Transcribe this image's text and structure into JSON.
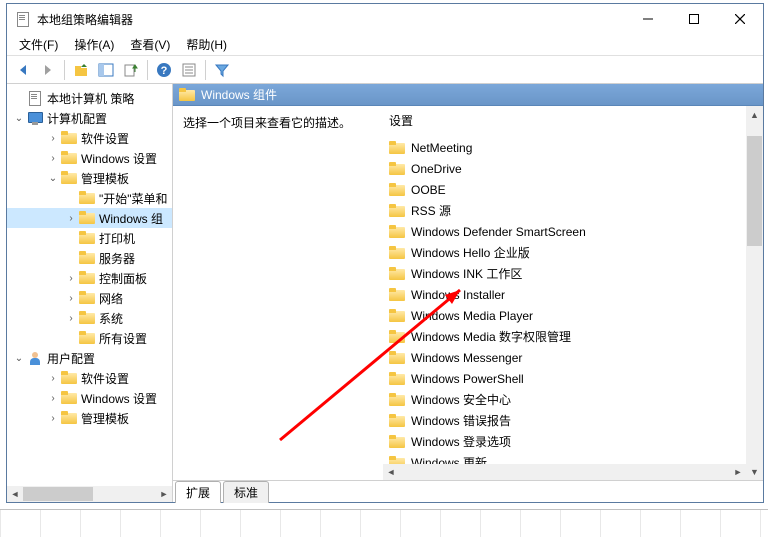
{
  "window": {
    "title": "本地组策略编辑器"
  },
  "menu": {
    "file": "文件(F)",
    "action": "操作(A)",
    "view": "查看(V)",
    "help": "帮助(H)"
  },
  "tree": {
    "root": "本地计算机 策略",
    "computer": "计算机配置",
    "software": "软件设置",
    "windows_settings": "Windows 设置",
    "admin_templates": "管理模板",
    "start_menu": "\"开始\"菜单和",
    "windows_components": "Windows 组",
    "printer": "打印机",
    "server": "服务器",
    "control_panel": "控制面板",
    "network": "网络",
    "system": "系统",
    "all_settings": "所有设置",
    "user": "用户配置",
    "user_software": "软件设置",
    "user_windows": "Windows 设置",
    "user_admin": "管理模板"
  },
  "right": {
    "header": "Windows 组件",
    "description": "选择一个项目来查看它的描述。",
    "column_header": "设置",
    "items": [
      "NetMeeting",
      "OneDrive",
      "OOBE",
      "RSS 源",
      "Windows Defender SmartScreen",
      "Windows Hello 企业版",
      "Windows INK 工作区",
      "Windows Installer",
      "Windows Media Player",
      "Windows Media 数字权限管理",
      "Windows Messenger",
      "Windows PowerShell",
      "Windows 安全中心",
      "Windows 错误报告",
      "Windows 登录选项",
      "Windows 更新"
    ]
  },
  "tabs": {
    "extended": "扩展",
    "standard": "标准"
  }
}
